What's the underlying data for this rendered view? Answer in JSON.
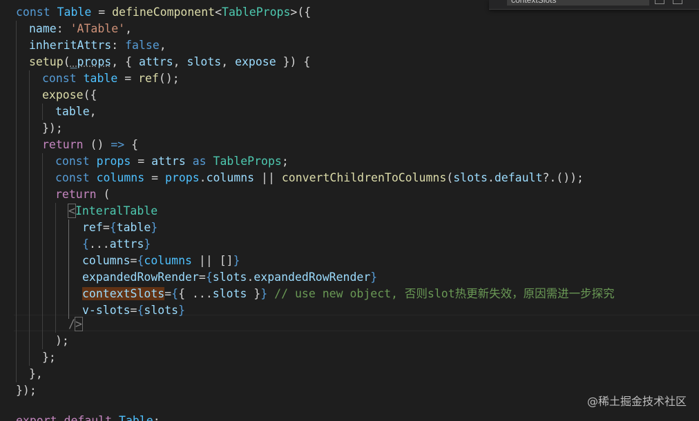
{
  "find_widget": {
    "search_value": "contextSlots"
  },
  "code": {
    "l1": {
      "a": "const ",
      "b": "Table",
      "c": " = ",
      "d": "defineComponent",
      "e": "<",
      "f": "TableProps",
      "g": ">({"
    },
    "l2": {
      "a": "name",
      "b": ": ",
      "c": "'ATable'",
      "d": ","
    },
    "l3": {
      "a": "inheritAttrs",
      "b": ": ",
      "c": "false",
      "d": ","
    },
    "l4": {
      "a": "setup",
      "b": "(",
      "c": "_props",
      "d": ", { ",
      "e": "attrs",
      "f": ", ",
      "g": "slots",
      "h": ", ",
      "i": "expose",
      "j": " }) {"
    },
    "l5": {
      "a": "const ",
      "b": "table",
      "c": " = ",
      "d": "ref",
      "e": "();"
    },
    "l6": {
      "a": "expose",
      "b": "({"
    },
    "l7": {
      "a": "table",
      "b": ","
    },
    "l8": {
      "a": "});"
    },
    "l9": {
      "a": "return",
      "b": " () ",
      "c": "=>",
      "d": " {"
    },
    "l10": {
      "a": "const ",
      "b": "props",
      "c": " = ",
      "d": "attrs",
      "e": " as ",
      "f": "TableProps",
      "g": ";"
    },
    "l11": {
      "a": "const ",
      "b": "columns",
      "c": " = ",
      "d": "props",
      "e": ".",
      "f": "columns",
      "g": " || ",
      "h": "convertChildrenToColumns",
      "i": "(",
      "j": "slots",
      "k": ".",
      "l": "default",
      "m": "?.());"
    },
    "l12": {
      "a": "return",
      "b": " ("
    },
    "l13": {
      "a": "<",
      "b": "InteralTable"
    },
    "l14": {
      "a": "ref",
      "b": "=",
      "c": "{",
      "d": "table",
      "e": "}"
    },
    "l15": {
      "a": "{",
      "b": "...",
      "c": "attrs",
      "d": "}"
    },
    "l16": {
      "a": "columns",
      "b": "=",
      "c": "{",
      "d": "columns",
      "e": " || ",
      "f": "[]",
      "g": "}"
    },
    "l17": {
      "a": "expandedRowRender",
      "b": "=",
      "c": "{",
      "d": "slots",
      "e": ".",
      "f": "expandedRowRender",
      "g": "}"
    },
    "l18": {
      "a": "contextSlots",
      "b": "=",
      "c": "{",
      "d": "{ ...",
      "e": "slots",
      "f": " }",
      "g": "}",
      "h": " // use new object, 否则slot热更新失效，原因需进一步探究"
    },
    "l19": {
      "a": "v-slots",
      "b": "=",
      "c": "{",
      "d": "slots",
      "e": "}"
    },
    "l20": {
      "a": "/",
      "b": ">"
    },
    "l21": {
      "a": ");"
    },
    "l22": {
      "a": "};"
    },
    "l23": {
      "a": "},"
    },
    "l24": {
      "a": "});"
    },
    "l25": {
      "a": "export default ",
      "b": "Table",
      "c": ";"
    }
  },
  "watermark": "@稀土掘金技术社区",
  "colors": {
    "background": "#1e1e1e",
    "keyword": "#569cd6",
    "control": "#c586c0",
    "function": "#dcdcaa",
    "type": "#4ec9b0",
    "variable": "#9cdcfe",
    "string": "#ce9178",
    "comment": "#6a9955",
    "highlight": "#613214"
  }
}
